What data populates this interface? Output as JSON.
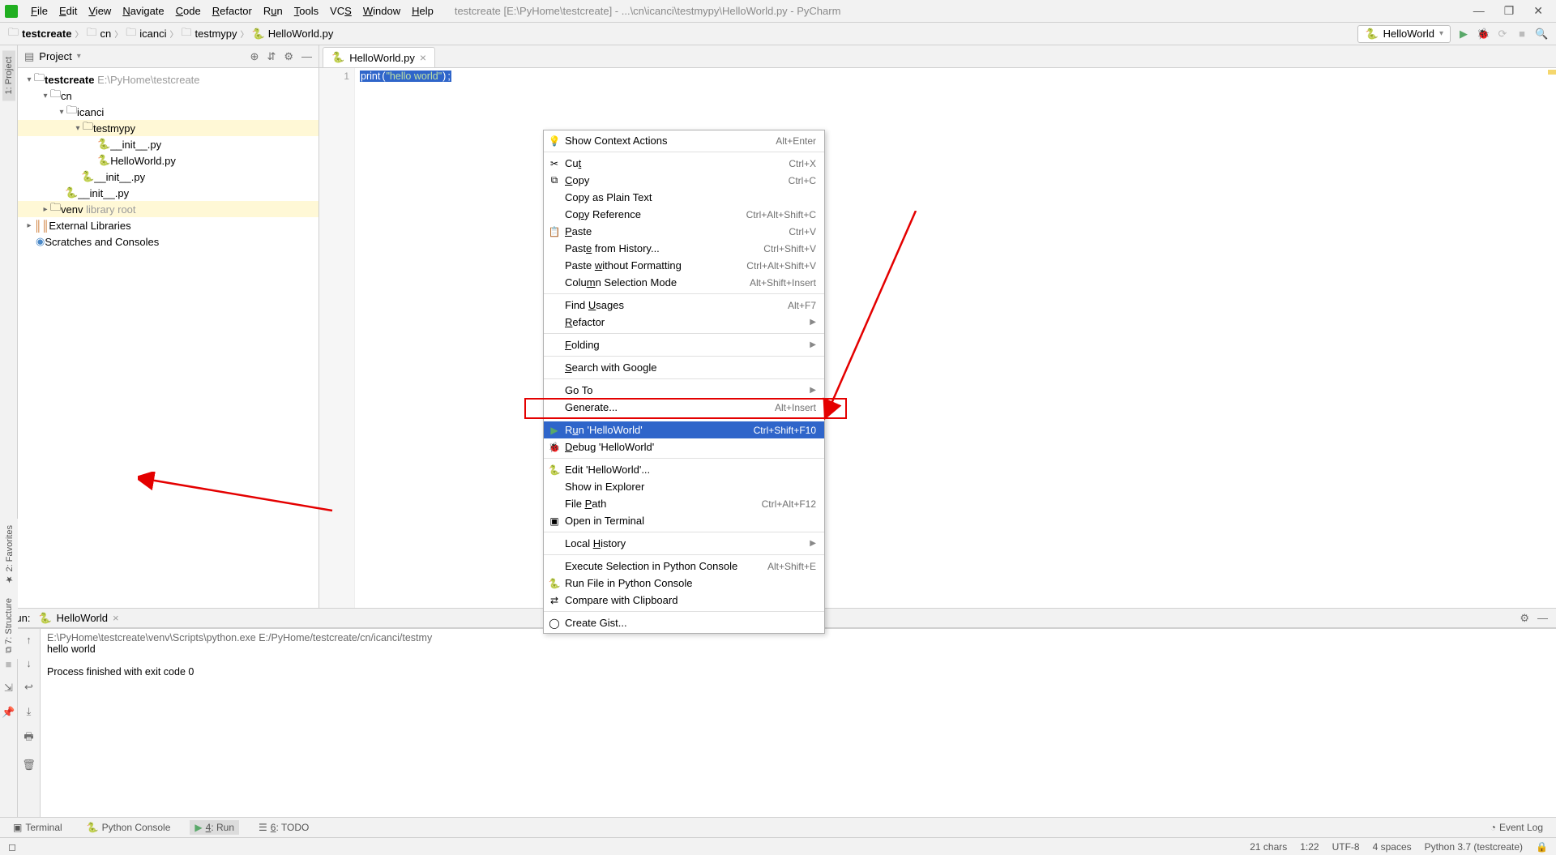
{
  "window": {
    "title": "testcreate [E:\\PyHome\\testcreate] - ...\\cn\\icanci\\testmypy\\HelloWorld.py - PyCharm"
  },
  "menus": {
    "file": "File",
    "edit": "Edit",
    "view": "View",
    "navigate": "Navigate",
    "code": "Code",
    "refactor": "Refactor",
    "run": "Run",
    "tools": "Tools",
    "vcs": "VCS",
    "window": "Window",
    "help": "Help"
  },
  "breadcrumb": {
    "root": "testcreate",
    "p1": "cn",
    "p2": "icanci",
    "p3": "testmypy",
    "file": "HelloWorld.py"
  },
  "run_config": "HelloWorld",
  "project_pane": {
    "title": "Project"
  },
  "tree": {
    "root": "testcreate",
    "root_path": "E:\\PyHome\\testcreate",
    "cn": "cn",
    "icanci": "icanci",
    "testmypy": "testmypy",
    "init1": "__init__.py",
    "hello": "HelloWorld.py",
    "init2": "__init__.py",
    "init3": "__init__.py",
    "venv": "venv",
    "venv_hint": "library root",
    "extlib": "External Libraries",
    "scratch": "Scratches and Consoles"
  },
  "editor": {
    "tab": "HelloWorld.py",
    "line_no": "1",
    "code_print": "print",
    "code_paren1": "(",
    "code_str": "\"hello world\"",
    "code_paren2": ")",
    "code_semi": ";"
  },
  "context_menu": [
    {
      "k": "show_ctx",
      "label": "Show Context Actions",
      "sc": "Alt+Enter",
      "icon": "💡"
    },
    {
      "sep": true
    },
    {
      "k": "cut",
      "label": "Cut",
      "u": "t",
      "sc": "Ctrl+X",
      "icon": "✂"
    },
    {
      "k": "copy",
      "label": "Copy",
      "u": "C",
      "sc": "Ctrl+C",
      "icon": "⧉"
    },
    {
      "k": "copy_plain",
      "label": "Copy as Plain Text"
    },
    {
      "k": "copy_ref",
      "label": "Copy Reference",
      "u": "p",
      "sc": "Ctrl+Alt+Shift+C"
    },
    {
      "k": "paste",
      "label": "Paste",
      "u": "P",
      "sc": "Ctrl+V",
      "icon": "📋"
    },
    {
      "k": "paste_hist",
      "label": "Paste from History...",
      "u": "e",
      "sc": "Ctrl+Shift+V"
    },
    {
      "k": "paste_nofmt",
      "label": "Paste without Formatting",
      "u": "w",
      "sc": "Ctrl+Alt+Shift+V"
    },
    {
      "k": "column",
      "label": "Column Selection Mode",
      "u": "M",
      "sc": "Alt+Shift+Insert"
    },
    {
      "sep": true
    },
    {
      "k": "find_usages",
      "label": "Find Usages",
      "u": "U",
      "sc": "Alt+F7"
    },
    {
      "k": "refactor",
      "label": "Refactor",
      "u": "R",
      "sub": true
    },
    {
      "sep": true
    },
    {
      "k": "folding",
      "label": "Folding",
      "u": "F",
      "sub": true
    },
    {
      "sep": true
    },
    {
      "k": "search_google",
      "label": "Search with Google",
      "u": "S"
    },
    {
      "sep": true
    },
    {
      "k": "goto",
      "label": "Go To",
      "sub": true
    },
    {
      "k": "generate",
      "label": "Generate...",
      "sc": "Alt+Insert"
    },
    {
      "sep": true
    },
    {
      "k": "run",
      "label": "Run 'HelloWorld'",
      "u": "u",
      "sc": "Ctrl+Shift+F10",
      "icon": "▶",
      "selected": true
    },
    {
      "k": "debug",
      "label": "Debug 'HelloWorld'",
      "u": "D",
      "icon": "🐞"
    },
    {
      "sep": true
    },
    {
      "k": "edit_cfg",
      "label": "Edit 'HelloWorld'...",
      "icon": "🐍"
    },
    {
      "k": "show_explorer",
      "label": "Show in Explorer"
    },
    {
      "k": "file_path",
      "label": "File Path",
      "u": "P",
      "sc": "Ctrl+Alt+F12"
    },
    {
      "k": "open_term",
      "label": "Open in Terminal",
      "icon": "▣"
    },
    {
      "sep": true
    },
    {
      "k": "local_hist",
      "label": "Local History",
      "u": "H",
      "sub": true
    },
    {
      "sep": true
    },
    {
      "k": "exec_console",
      "label": "Execute Selection in Python Console",
      "sc": "Alt+Shift+E"
    },
    {
      "k": "run_file_console",
      "label": "Run File in Python Console",
      "icon": "🐍"
    },
    {
      "k": "compare_clip",
      "label": "Compare with Clipboard",
      "icon": "⇄"
    },
    {
      "sep": true
    },
    {
      "k": "gist",
      "label": "Create Gist...",
      "icon": "◯"
    }
  ],
  "run_tool": {
    "label": "Run:",
    "config": "HelloWorld",
    "line1": "E:\\PyHome\\testcreate\\venv\\Scripts\\python.exe E:/PyHome/testcreate/cn/icanci/testmy",
    "line2": "hello world",
    "line3": "Process finished with exit code 0"
  },
  "bottom_tabs": {
    "terminal": "Terminal",
    "pyconsole": "Python Console",
    "run": "4: Run",
    "run_u": "4",
    "todo": "6: TODO",
    "todo_u": "6",
    "eventlog": "Event Log"
  },
  "status": {
    "chars": "21 chars",
    "pos": "1:22",
    "enc": "UTF-8",
    "indent": "4 spaces",
    "py": "Python 3.7 (testcreate)"
  },
  "side_tabs": {
    "project": "1: Project",
    "structure": "7: Structure",
    "favorites": "2: Favorites"
  }
}
